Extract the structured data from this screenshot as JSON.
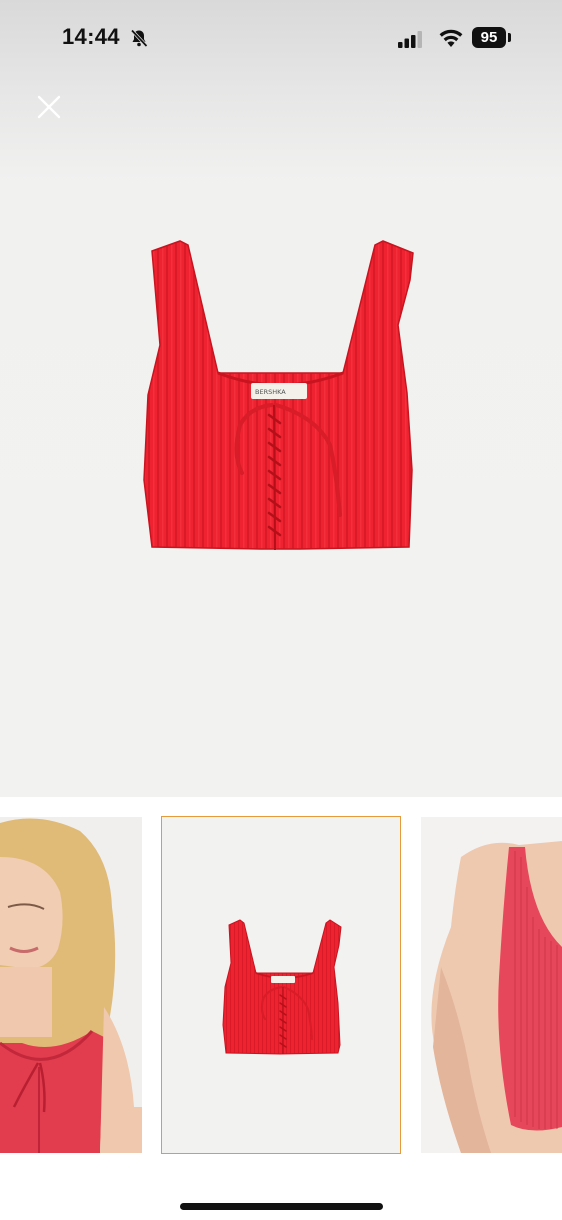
{
  "status_bar": {
    "time": "14:44",
    "battery_level": "95",
    "icons": [
      "bell-slash-icon",
      "cellular-signal-icon",
      "wifi-icon",
      "battery-icon"
    ]
  },
  "viewer": {
    "close_icon": "close-icon",
    "main_image": "red ribbed lace-up knit crop top",
    "background_color": "#f2f2f1"
  },
  "product": {
    "color": "#ee2230",
    "label_text": "BERSHKA"
  },
  "thumbnails": [
    {
      "name": "model-front",
      "selected": false
    },
    {
      "name": "product-flat",
      "selected": true
    },
    {
      "name": "model-side",
      "selected": false
    }
  ],
  "accent": {
    "selected_border": "#e59a3c"
  }
}
